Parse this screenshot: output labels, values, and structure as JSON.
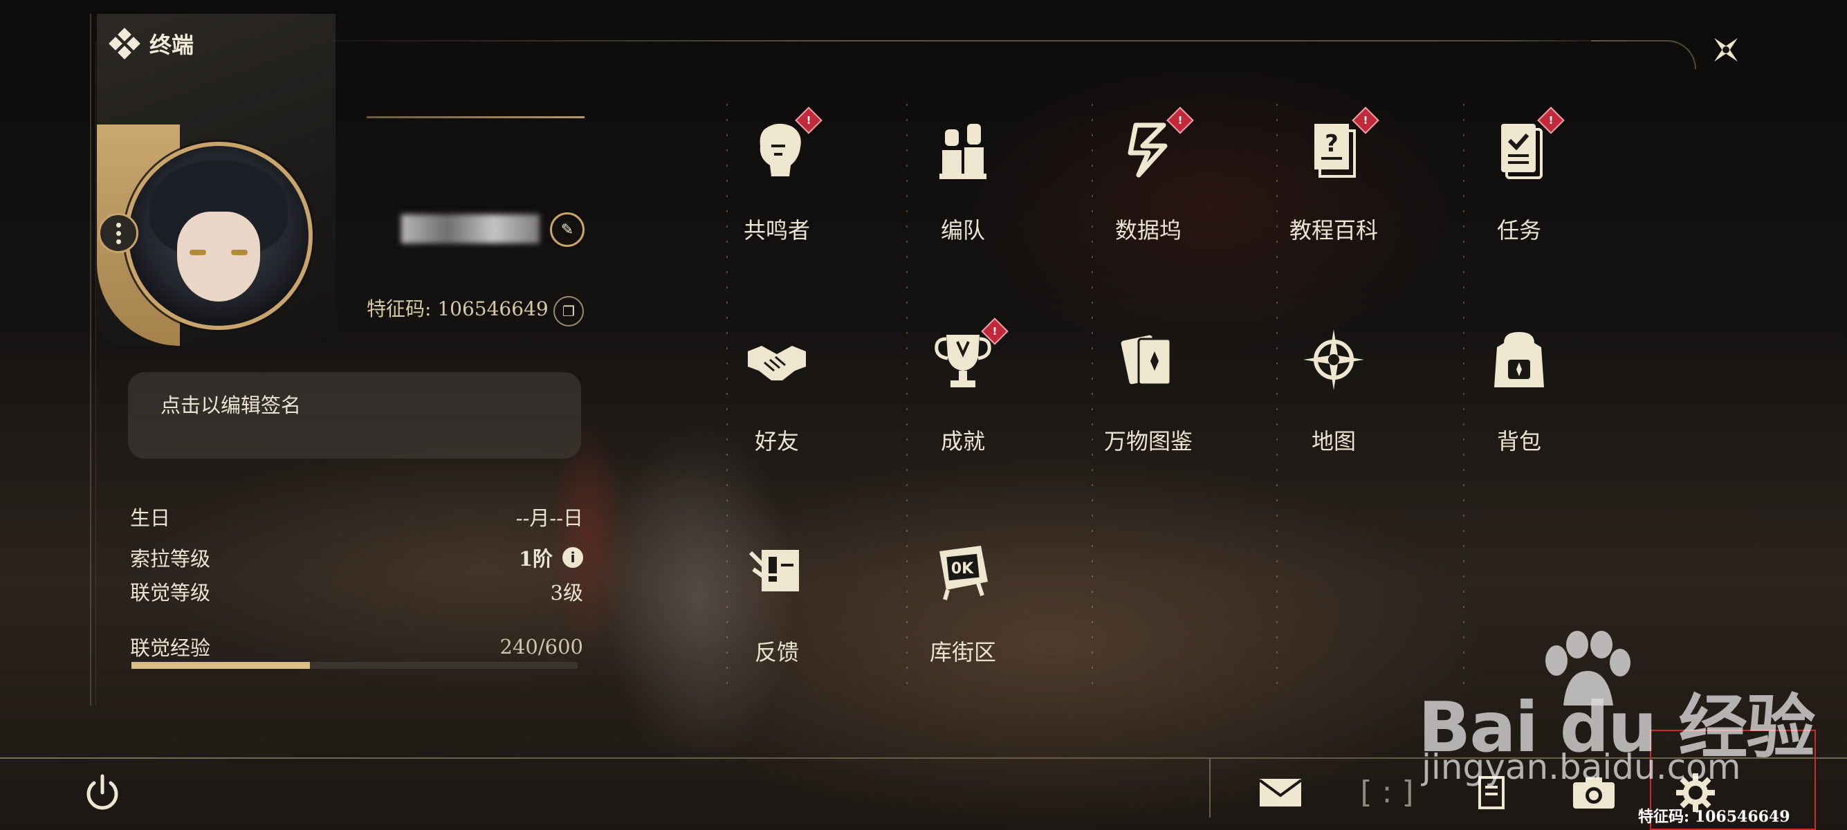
{
  "header": {
    "title": "终端",
    "close_icon": "close-x-icon"
  },
  "profile": {
    "uid_label": "特征码: 106546649",
    "signature_placeholder": "点击以编辑签名",
    "rows": [
      {
        "label": "生日",
        "value": "--月--日"
      },
      {
        "label": "索拉等级",
        "value": "1阶"
      },
      {
        "label": "联觉等级",
        "value": "3级"
      },
      {
        "label": "联觉经验",
        "value": "240/600"
      }
    ],
    "exp_progress": 0.4
  },
  "menu": [
    {
      "label": "共鸣者",
      "icon": "resonator-icon",
      "badge": "!"
    },
    {
      "label": "编队",
      "icon": "team-icon",
      "badge": ""
    },
    {
      "label": "数据坞",
      "icon": "databank-icon",
      "badge": "!"
    },
    {
      "label": "教程百科",
      "icon": "tutorial-book-icon",
      "badge": "!"
    },
    {
      "label": "任务",
      "icon": "quest-icon",
      "badge": "!"
    },
    {
      "label": "好友",
      "icon": "handshake-icon",
      "badge": ""
    },
    {
      "label": "成就",
      "icon": "trophy-icon",
      "badge": "!"
    },
    {
      "label": "万物图鉴",
      "icon": "cards-icon",
      "badge": ""
    },
    {
      "label": "地图",
      "icon": "compass-icon",
      "badge": ""
    },
    {
      "label": "背包",
      "icon": "backpack-icon",
      "badge": ""
    },
    {
      "label": "反馈",
      "icon": "feedback-icon",
      "badge": ""
    },
    {
      "label": "库街区",
      "icon": "kuro-street-icon",
      "badge": ""
    }
  ],
  "bottom_bar": {
    "bracket_text": "[ : ]",
    "uid_label": "特征码: 106546649"
  },
  "watermark": {
    "big": "Bai du 经验",
    "small": "jingyan.baidu.com"
  },
  "colors": {
    "accent_gold": "#c9a56b",
    "badge_red": "#c2293b",
    "text": "#ece4d2"
  }
}
